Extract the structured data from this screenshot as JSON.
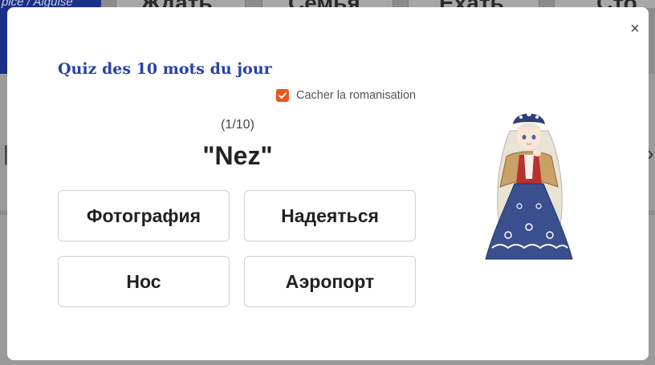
{
  "background": {
    "top_left_text": "pice / Aiguise",
    "cards": [
      "Ждать",
      "Семья",
      "Ехать",
      "Сто"
    ]
  },
  "modal": {
    "title": "Quiz des 10 mots du jour",
    "close_label": "×",
    "romanization_label": "Cacher la romanisation",
    "romanization_checked": true,
    "progress": "(1/10)",
    "prompt": "\"Nez\"",
    "answers": [
      "Фотография",
      "Надеяться",
      "Нос",
      "Аэропорт"
    ],
    "mascot": "russian-girl-mascot"
  },
  "colors": {
    "title": "#2743a6",
    "checkbox": "#e8561f",
    "overlay": "#8a8a8a",
    "brand_blue": "#1a2f86"
  }
}
